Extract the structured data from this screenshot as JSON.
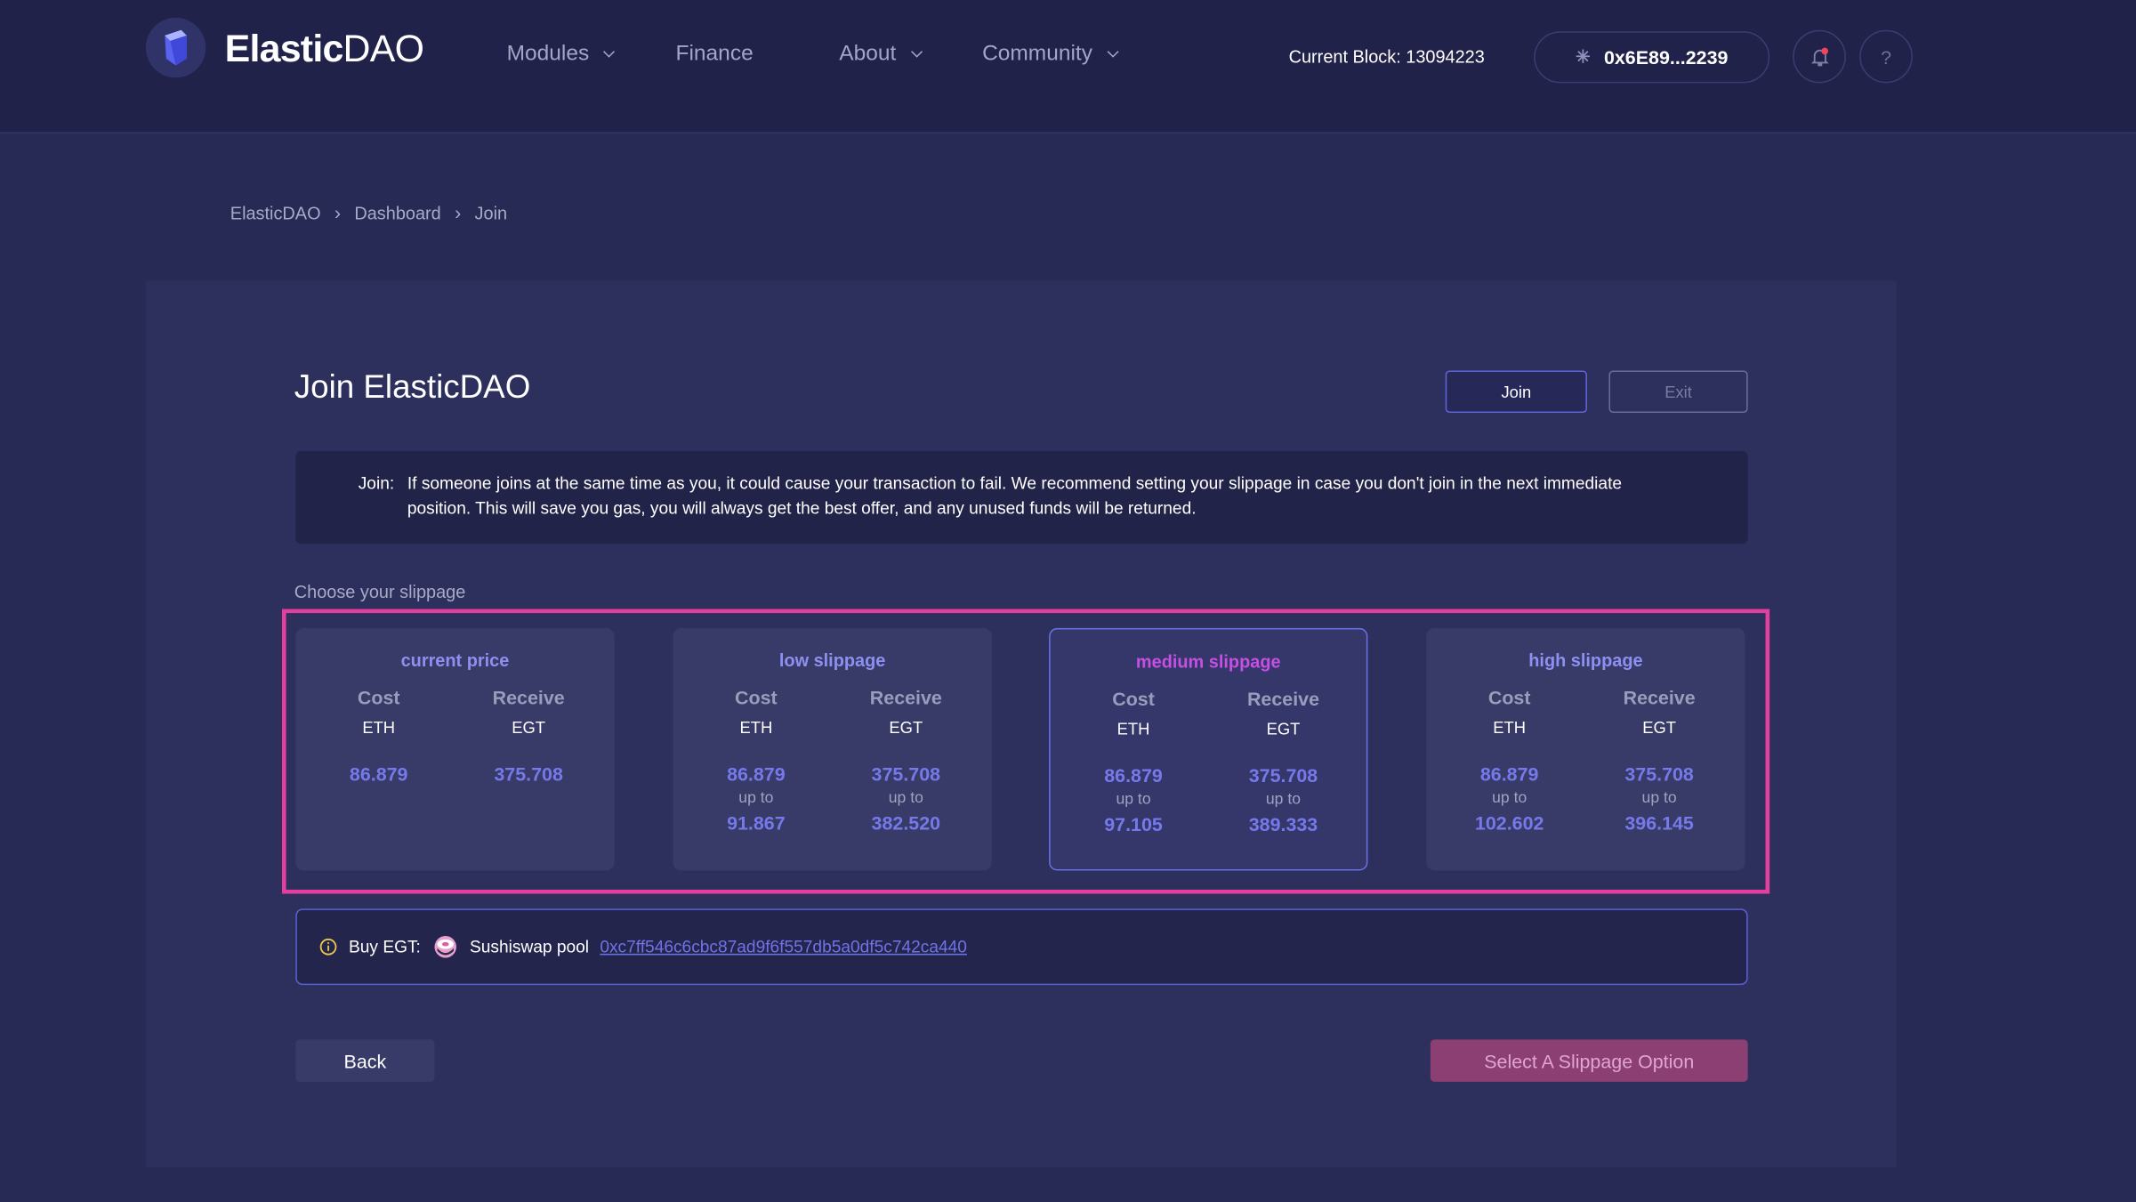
{
  "header": {
    "brand_bold": "Elastic",
    "brand_light": "DAO",
    "nav": [
      {
        "label": "Modules",
        "dropdown": true
      },
      {
        "label": "Finance",
        "dropdown": false
      },
      {
        "label": "About",
        "dropdown": true
      },
      {
        "label": "Community",
        "dropdown": true
      }
    ],
    "current_block": "Current Block: 13094223",
    "wallet": "0x6E89...2239",
    "help": "?"
  },
  "breadcrumb": [
    "ElasticDAO",
    "Dashboard",
    "Join"
  ],
  "main": {
    "title": "Join ElasticDAO",
    "join_label": "Join",
    "exit_label": "Exit",
    "info_label": "Join:",
    "info_text": "If someone joins at the same time as you, it could cause your transaction to fail. We recommend setting your slippage in case you don't join in the next immediate position. This will save you gas, you will always get the best offer, and any unused funds will be returned.",
    "choose_label": "Choose your slippage",
    "cards": [
      {
        "title": "current price",
        "cost_label": "Cost",
        "receive_label": "Receive",
        "cost_unit": "ETH",
        "receive_unit": "EGT",
        "cost": "86.879",
        "receive": "375.708",
        "up_to": "",
        "cost_max": "",
        "receive_max": ""
      },
      {
        "title": "low slippage",
        "cost_label": "Cost",
        "receive_label": "Receive",
        "cost_unit": "ETH",
        "receive_unit": "EGT",
        "cost": "86.879",
        "receive": "375.708",
        "up_to": "up to",
        "cost_max": "91.867",
        "receive_max": "382.520"
      },
      {
        "title": "medium slippage",
        "cost_label": "Cost",
        "receive_label": "Receive",
        "cost_unit": "ETH",
        "receive_unit": "EGT",
        "cost": "86.879",
        "receive": "375.708",
        "up_to": "up to",
        "cost_max": "97.105",
        "receive_max": "389.333",
        "selected": true
      },
      {
        "title": "high slippage",
        "cost_label": "Cost",
        "receive_label": "Receive",
        "cost_unit": "ETH",
        "receive_unit": "EGT",
        "cost": "86.879",
        "receive": "375.708",
        "up_to": "up to",
        "cost_max": "102.602",
        "receive_max": "396.145"
      }
    ],
    "buy_label": "Buy EGT:",
    "pool_label": "Sushiswap pool",
    "pool_address": "0xc7ff546c6cbc87ad9f6f557db5a0df5c742ca440",
    "back_label": "Back",
    "select_label": "Select A Slippage Option"
  },
  "colors": {
    "accent": "#5f64d8",
    "highlight": "#e33f9f",
    "value": "#7579ea",
    "selected_title": "#c64fe4",
    "cta": "#8b3f72"
  }
}
